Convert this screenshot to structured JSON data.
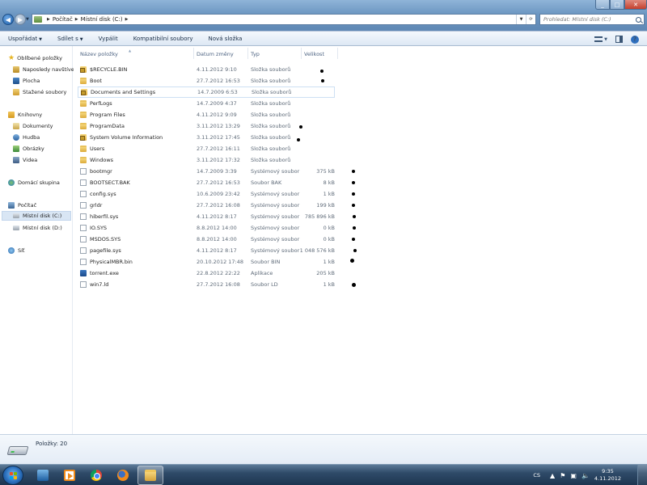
{
  "address": {
    "crumbs": [
      "Počítač",
      "Místní disk (C:)"
    ]
  },
  "search": {
    "placeholder": "Prohledat: Místní disk (C:)"
  },
  "toolbar": {
    "organize": "Uspořádat",
    "share": "Sdílet s",
    "burn": "Vypálit",
    "compat": "Kompatibilní soubory",
    "newfolder": "Nová složka"
  },
  "nav": {
    "favorites": "Oblíbené položky",
    "recent": "Naposledy navštívené",
    "desktop": "Plocha",
    "downloads": "Stažené soubory",
    "libraries": "Knihovny",
    "documents": "Dokumenty",
    "music": "Hudba",
    "pictures": "Obrázky",
    "videos": "Videa",
    "homegroup": "Domácí skupina",
    "computer": "Počítač",
    "drive_c": "Místní disk (C:)",
    "drive_d": "Místní disk (D:)",
    "network": "Síť"
  },
  "columns": {
    "name": "Název položky",
    "date": "Datum změny",
    "type": "Typ",
    "size": "Velikost"
  },
  "files": [
    {
      "name": "$RECYCLE.BIN",
      "date": "4.11.2012 9:10",
      "type": "Složka souborů",
      "size": "",
      "icon": "lock-folder-icon"
    },
    {
      "name": "Boot",
      "date": "27.7.2012 16:53",
      "type": "Složka souborů",
      "size": "",
      "icon": "folder-icon"
    },
    {
      "name": "Documents and Settings",
      "date": "14.7.2009 6:53",
      "type": "Složka souborů",
      "size": "",
      "icon": "lock-folder-icon"
    },
    {
      "name": "PerfLogs",
      "date": "14.7.2009 4:37",
      "type": "Složka souborů",
      "size": "",
      "icon": "folder-icon"
    },
    {
      "name": "Program Files",
      "date": "4.11.2012 9:09",
      "type": "Složka souborů",
      "size": "",
      "icon": "folder-icon"
    },
    {
      "name": "ProgramData",
      "date": "3.11.2012 13:29",
      "type": "Složka souborů",
      "size": "",
      "icon": "folder-icon"
    },
    {
      "name": "System Volume Information",
      "date": "3.11.2012 17:45",
      "type": "Složka souborů",
      "size": "",
      "icon": "lock-folder-icon"
    },
    {
      "name": "Users",
      "date": "27.7.2012 16:11",
      "type": "Složka souborů",
      "size": "",
      "icon": "folder-icon"
    },
    {
      "name": "Windows",
      "date": "3.11.2012 17:32",
      "type": "Složka souborů",
      "size": "",
      "icon": "folder-icon"
    },
    {
      "name": "bootmgr",
      "date": "14.7.2009 3:39",
      "type": "Systémový soubor",
      "size": "375 kB",
      "icon": "file-icon"
    },
    {
      "name": "BOOTSECT.BAK",
      "date": "27.7.2012 16:53",
      "type": "Soubor BAK",
      "size": "8 kB",
      "icon": "file-icon"
    },
    {
      "name": "config.sys",
      "date": "10.6.2009 23:42",
      "type": "Systémový soubor",
      "size": "1 kB",
      "icon": "file-icon"
    },
    {
      "name": "grldr",
      "date": "27.7.2012 16:08",
      "type": "Systémový soubor",
      "size": "199 kB",
      "icon": "file-icon"
    },
    {
      "name": "hiberfil.sys",
      "date": "4.11.2012 8:17",
      "type": "Systémový soubor",
      "size": "785 896 kB",
      "icon": "file-icon"
    },
    {
      "name": "IO.SYS",
      "date": "8.8.2012 14:00",
      "type": "Systémový soubor",
      "size": "0 kB",
      "icon": "file-icon"
    },
    {
      "name": "MSDOS.SYS",
      "date": "8.8.2012 14:00",
      "type": "Systémový soubor",
      "size": "0 kB",
      "icon": "file-icon"
    },
    {
      "name": "pagefile.sys",
      "date": "4.11.2012 8:17",
      "type": "Systémový soubor",
      "size": "1 048 576 kB",
      "icon": "file-icon"
    },
    {
      "name": "PhysicalMBR.bin",
      "date": "20.10.2012 17:48",
      "type": "Soubor BIN",
      "size": "1 kB",
      "icon": "file-icon"
    },
    {
      "name": "torrent.exe",
      "date": "22.8.2012 22:22",
      "type": "Aplikace",
      "size": "205 kB",
      "icon": "exe-icon"
    },
    {
      "name": "win7.ld",
      "date": "27.7.2012 16:08",
      "type": "Soubor LD",
      "size": "1 kB",
      "icon": "file-icon"
    }
  ],
  "details": {
    "count": "Položky: 20"
  },
  "tray": {
    "lang": "CS",
    "time": "9:35",
    "date": "4.11.2012"
  }
}
